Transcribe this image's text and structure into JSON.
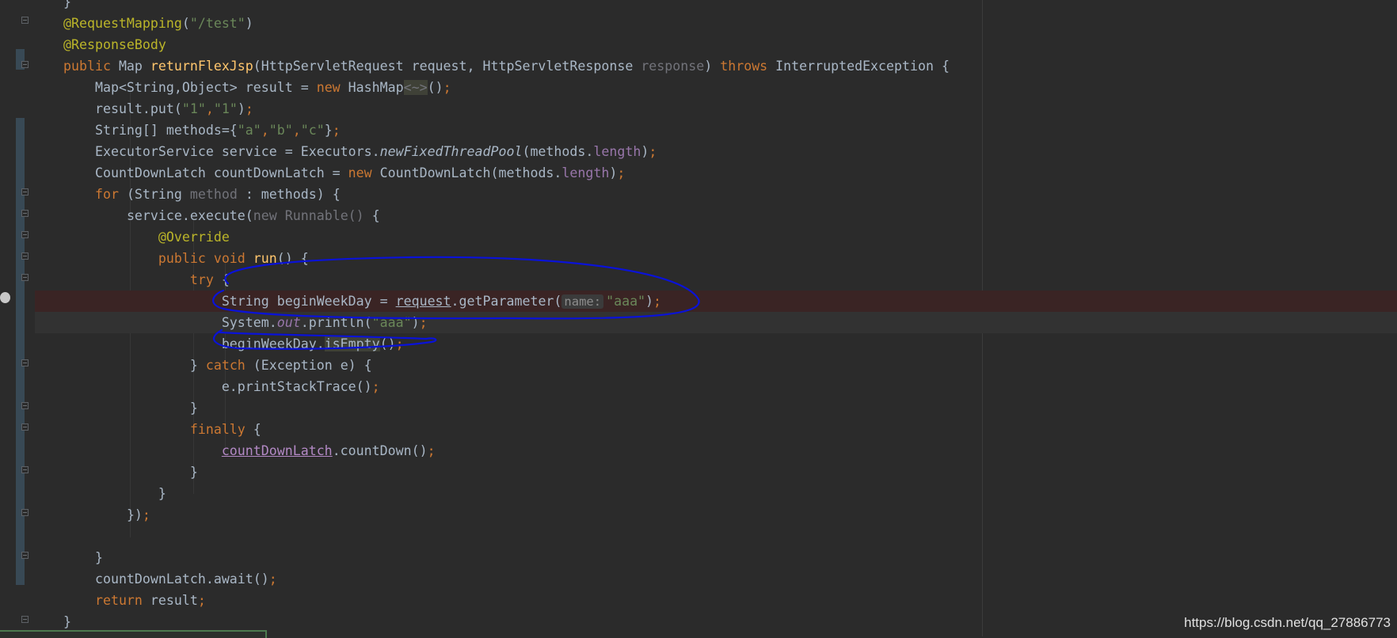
{
  "code": {
    "l0": "}",
    "l1": {
      "ann": "@RequestMapping",
      "p1": "(",
      "str": "\"/test\"",
      "p2": ")"
    },
    "l2": {
      "ann": "@ResponseBody"
    },
    "l3": {
      "kw1": "public ",
      "t1": "Map ",
      "fn": "returnFlexJsp",
      "t2": "(HttpServletRequest request, HttpServletResponse ",
      "unused": "response",
      "t3": ") ",
      "kw2": "throws ",
      "t4": "InterruptedException {"
    },
    "l4": {
      "t1": "Map<String,Object> result = ",
      "kw": "new ",
      "t2": "HashMap",
      "diamond": "<~>",
      "t3": "()",
      "semi": ";"
    },
    "l5": {
      "t1": "result.put(",
      "s1": "\"1\"",
      "c": ",",
      "s2": "\"1\"",
      "t2": ")",
      "semi": ";"
    },
    "l6": {
      "t1": "String[] methods={",
      "s1": "\"a\"",
      "c1": ",",
      "s2": "\"b\"",
      "c2": ",",
      "s3": "\"c\"",
      "t2": "}",
      "semi": ";"
    },
    "l7": {
      "t1": "ExecutorService service = Executors.",
      "it": "newFixedThreadPool",
      "t2": "(methods.",
      "fld": "length",
      "t3": ")",
      "semi": ";"
    },
    "l8": {
      "t1": "CountDownLatch countDownLatch = ",
      "kw": "new ",
      "t2": "CountDownLatch(methods.",
      "fld": "length",
      "t3": ")",
      "semi": ";"
    },
    "l9": {
      "kw": "for ",
      "t1": "(String ",
      "unused": "method",
      "t2": " : methods) {"
    },
    "l10": {
      "t1": "service.execute(",
      "unused": "new Runnable()",
      "t2": " {"
    },
    "l11": {
      "ann": "@Override"
    },
    "l12": {
      "kw": "public void ",
      "fn": "run",
      "t1": "() {"
    },
    "l13": {
      "kw": "try ",
      "t1": "{"
    },
    "l14": {
      "t1": "String beginWeekDay = ",
      "und": "request",
      "t2": ".getParameter(",
      "hint": "name:",
      "str": "\"aaa\"",
      "t3": ")",
      "semi": ";"
    },
    "l15": {
      "t1": "System.",
      "it": "out",
      "t2": ".println(",
      "str": "\"aaa\"",
      "t3": ")",
      "semi": ";"
    },
    "l16": {
      "t1": "beginWeekDay.",
      "hl": "isEmpty",
      "t2": "()",
      "semi": ";"
    },
    "l17": {
      "t1": "} ",
      "kw": "catch ",
      "t2": "(Exception e) {"
    },
    "l18": {
      "t1": "e.printStackTrace()",
      "semi": ";"
    },
    "l19": "}",
    "l20": {
      "kw": "finally ",
      "t1": "{"
    },
    "l21": {
      "und": "countDownLatch",
      "t1": ".countDown()",
      "semi": ";"
    },
    "l22": "}",
    "l23": "}",
    "l24": {
      "t1": "})",
      "semi": ";"
    },
    "l26": "}",
    "l27": {
      "t1": "countDownLatch.await()",
      "semi": ";"
    },
    "l28": {
      "kw": "return ",
      "t1": "result",
      "semi": ";"
    },
    "l29": "}"
  },
  "watermark": "https://blog.csdn.net/qq_27886773",
  "colors": {
    "background": "#2b2b2b",
    "keyword": "#cc7832",
    "annotation": "#bbb529",
    "string": "#6a8759",
    "method_decl": "#ffc66d",
    "field": "#9876aa",
    "annotation_ink": "#0a12d8"
  }
}
